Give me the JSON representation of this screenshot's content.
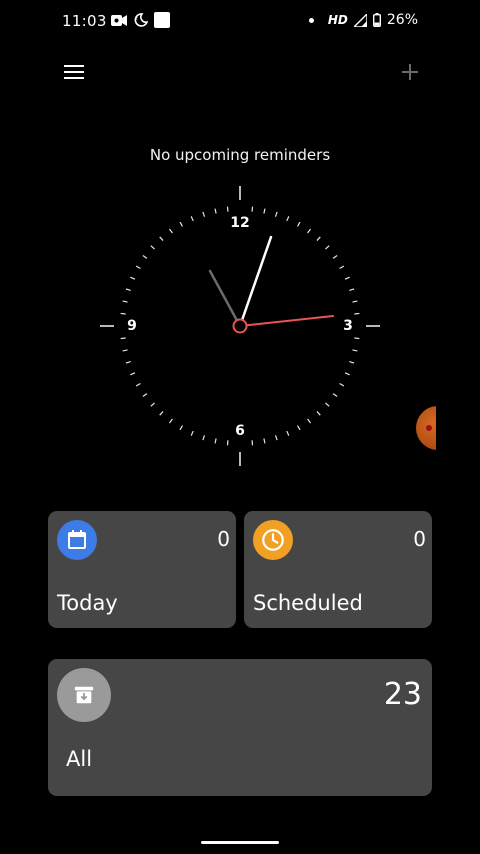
{
  "status_bar": {
    "time": "11:03",
    "network": "HD",
    "battery": "26%"
  },
  "toolbar": {
    "menu_icon": "hamburger-menu-icon",
    "add_icon": "plus-icon"
  },
  "upcoming_text": "No upcoming reminders",
  "clock": {
    "numerals": [
      "12",
      "3",
      "6",
      "9"
    ],
    "time_shown": "11:03"
  },
  "cards": {
    "today": {
      "label": "Today",
      "count": "0",
      "icon": "calendar-icon",
      "color": "#3d7be5"
    },
    "scheduled": {
      "label": "Scheduled",
      "count": "0",
      "icon": "clock-icon",
      "color": "#f2a024"
    },
    "all": {
      "label": "All",
      "count": "23",
      "icon": "archive-icon",
      "color": "#9a9a9a"
    }
  },
  "colors": {
    "background": "#000000",
    "card": "#464646",
    "second_hand": "#e85555"
  }
}
